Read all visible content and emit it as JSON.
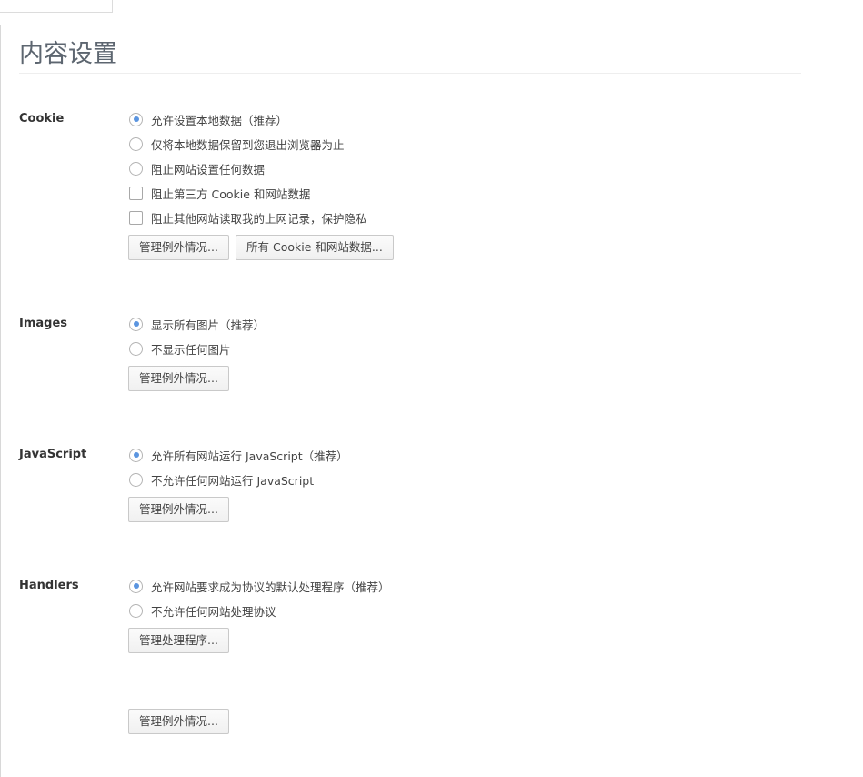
{
  "page_title": "内容设置",
  "cookie": {
    "label": "Cookie",
    "options": [
      "允许设置本地数据（推荐）",
      "仅将本地数据保留到您退出浏览器为止",
      "阻止网站设置任何数据",
      "阻止第三方 Cookie 和网站数据",
      "阻止其他网站读取我的上网记录，保护隐私"
    ],
    "selected_option": "允许设置本地数据（推荐）",
    "manage_button": "管理例外情况...",
    "all_cookies_button": "所有 Cookie 和网站数据..."
  },
  "images": {
    "label": "Images",
    "options": [
      "显示所有图片（推荐）",
      "不显示任何图片"
    ],
    "selected_option": "显示所有图片（推荐）",
    "manage_button": "管理例外情况..."
  },
  "javascript": {
    "label": "JavaScript",
    "options": [
      "允许所有网站运行 JavaScript（推荐）",
      "不允许任何网站运行 JavaScript"
    ],
    "selected_option": "允许所有网站运行 JavaScript（推荐）",
    "manage_button": "管理例外情况..."
  },
  "handlers": {
    "label": "Handlers",
    "options": [
      "允许网站要求成为协议的默认处理程序（推荐）",
      "不允许任何网站处理协议"
    ],
    "selected_option": "允许网站要求成为协议的默认处理程序（推荐）",
    "manage_button": "管理处理程序..."
  },
  "extra": {
    "manage_button": "管理例外情况..."
  },
  "colors": {
    "accent": "#5b95e0",
    "title": "#5d6670"
  }
}
